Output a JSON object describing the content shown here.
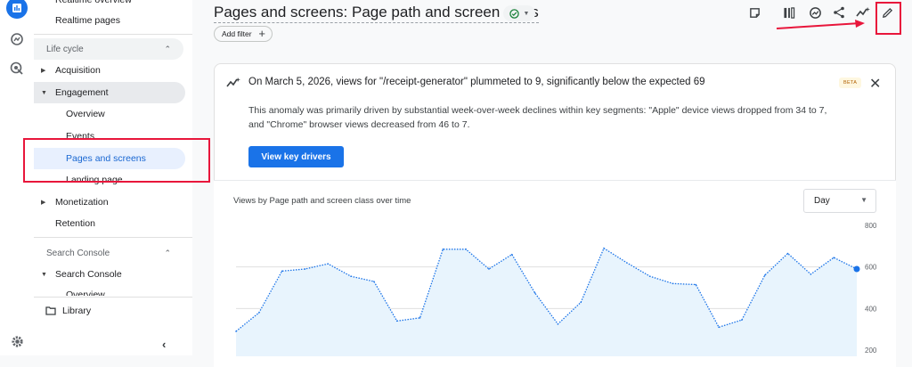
{
  "sidebar": {
    "realtime_overview": "Realtime overview",
    "realtime_pages": "Realtime pages",
    "lifecycle": "Life cycle",
    "acquisition": "Acquisition",
    "engagement": "Engagement",
    "overview": "Overview",
    "events": "Events",
    "pages_and_screens": "Pages and screens",
    "landing_page": "Landing page",
    "monetization": "Monetization",
    "retention": "Retention",
    "search_console_section": "Search Console",
    "search_console": "Search Console",
    "library": "Library",
    "collapse_icon": "chevron-left-icon"
  },
  "header": {
    "title": "Pages and screens: Page path and screen class",
    "add_filter": "Add filter"
  },
  "toolbar": {
    "icons": [
      "compare-icon",
      "customize-icon",
      "insights-icon",
      "share-icon",
      "trend-icon",
      "edit-icon"
    ]
  },
  "insight": {
    "headline": "On March 5, 2026, views for \"/receipt-generator\" plummeted to 9, significantly below the expected 69",
    "body": "This anomaly was primarily driven by substantial week-over-week declines within key segments: \"Apple\" device views dropped from 34 to 7, and \"Chrome\" browser views decreased from 46 to 7.",
    "beta": "BETA",
    "button": "View key drivers"
  },
  "chart": {
    "title": "Views by Page path and screen class over time",
    "granularity": "Day",
    "accent": "#1a73e8"
  },
  "chart_data": {
    "type": "area",
    "title": "Views by Page path and screen class over time",
    "yticks": [
      "800",
      "600",
      "400",
      "200"
    ],
    "ylim": [
      200,
      800
    ],
    "series": [
      {
        "values": [
          290,
          380,
          580,
          590,
          615,
          555,
          530,
          340,
          355,
          685,
          685,
          590,
          660,
          475,
          325,
          430,
          690,
          620,
          555,
          520,
          515,
          310,
          345,
          560,
          665,
          565,
          645,
          590
        ]
      }
    ]
  }
}
